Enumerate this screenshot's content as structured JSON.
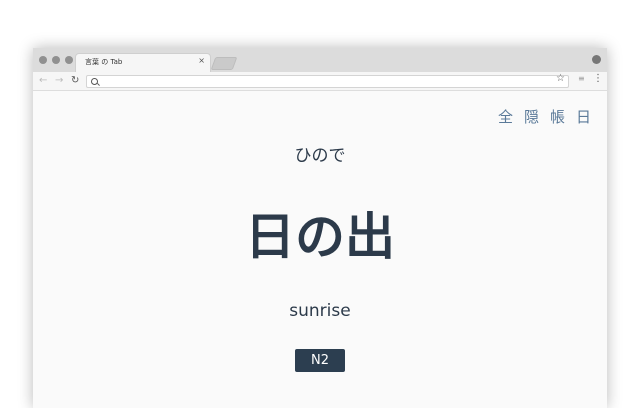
{
  "browser": {
    "tab_title": "言葉 の Tab",
    "tab_close": "×",
    "omnibox_value": ""
  },
  "top_links": [
    "全",
    "隠",
    "帳",
    "日"
  ],
  "card": {
    "reading": "ひので",
    "word": "日の出",
    "meaning": "sunrise",
    "level": "N2"
  },
  "icons": {
    "back": "arrow-left-icon",
    "forward": "arrow-right-icon",
    "reload": "reload-icon",
    "search": "search-icon",
    "bookmark": "star-icon",
    "extensions": "extensions-icon",
    "menu": "kebab-menu-icon",
    "profile": "profile-icon"
  },
  "colors": {
    "text": "#2c3a4a",
    "accent_link": "#5b7a99",
    "badge_bg": "#2c3e50"
  }
}
